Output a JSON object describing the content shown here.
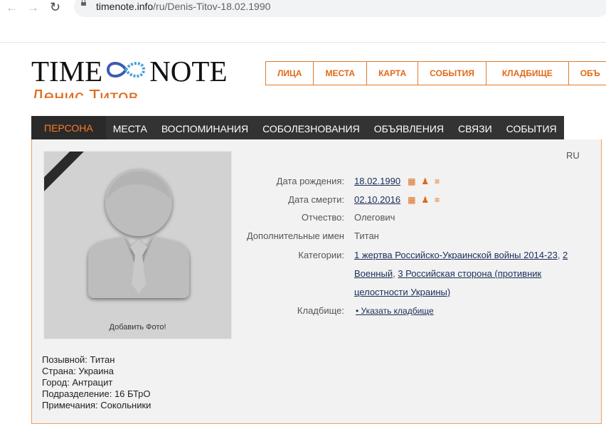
{
  "browser": {
    "url_host": "timenote.info",
    "url_path": "/ru/Denis-Titov-18.02.1990"
  },
  "logo": {
    "left": "TIME",
    "right": "NOTE"
  },
  "top_menu": [
    "ЛИЦА",
    "МЕСТА",
    "КАРТА",
    "СОБЫТИЯ",
    "КЛАДБИЩЕ",
    "ОБЪ"
  ],
  "page_title": "Денис Титов",
  "tabs": [
    "ПЕРСОНА",
    "МЕСТА",
    "ВОСПОМИНАНИЯ",
    "СОБОЛЕЗНОВАНИЯ",
    "ОБЪЯВЛЕНИЯ",
    "СВЯЗИ",
    "СОБЫТИЯ"
  ],
  "profile": {
    "add_photo": "Добавить Фото!",
    "lang": "RU",
    "birth_label": "Дата рождения:",
    "birth_value": "18.02.1990",
    "death_label": "Дата смерти:",
    "death_value": "02.10.2016",
    "patronymic_label": "Отчество:",
    "patronymic_value": "Олегович",
    "extra_names_label": "Дополнительные имен",
    "extra_names_value": "Титан",
    "categories_label": "Категории:",
    "categories": [
      "1 жертва Российско-Украинской войны 2014-23",
      "2 Военный",
      "3 Российская сторона (противник целостности Украины)"
    ],
    "cemetery_label": "Кладбище:",
    "cemetery_value": "• Указать кладбище"
  },
  "bio": [
    "Позывной: Титан",
    "Страна: Украина",
    "Город: Антрацит",
    "Подразделение: 16 БТрО",
    "Примечания: Сокольники"
  ],
  "colors": {
    "accent": "#e0691a",
    "tabbar": "#333333"
  }
}
